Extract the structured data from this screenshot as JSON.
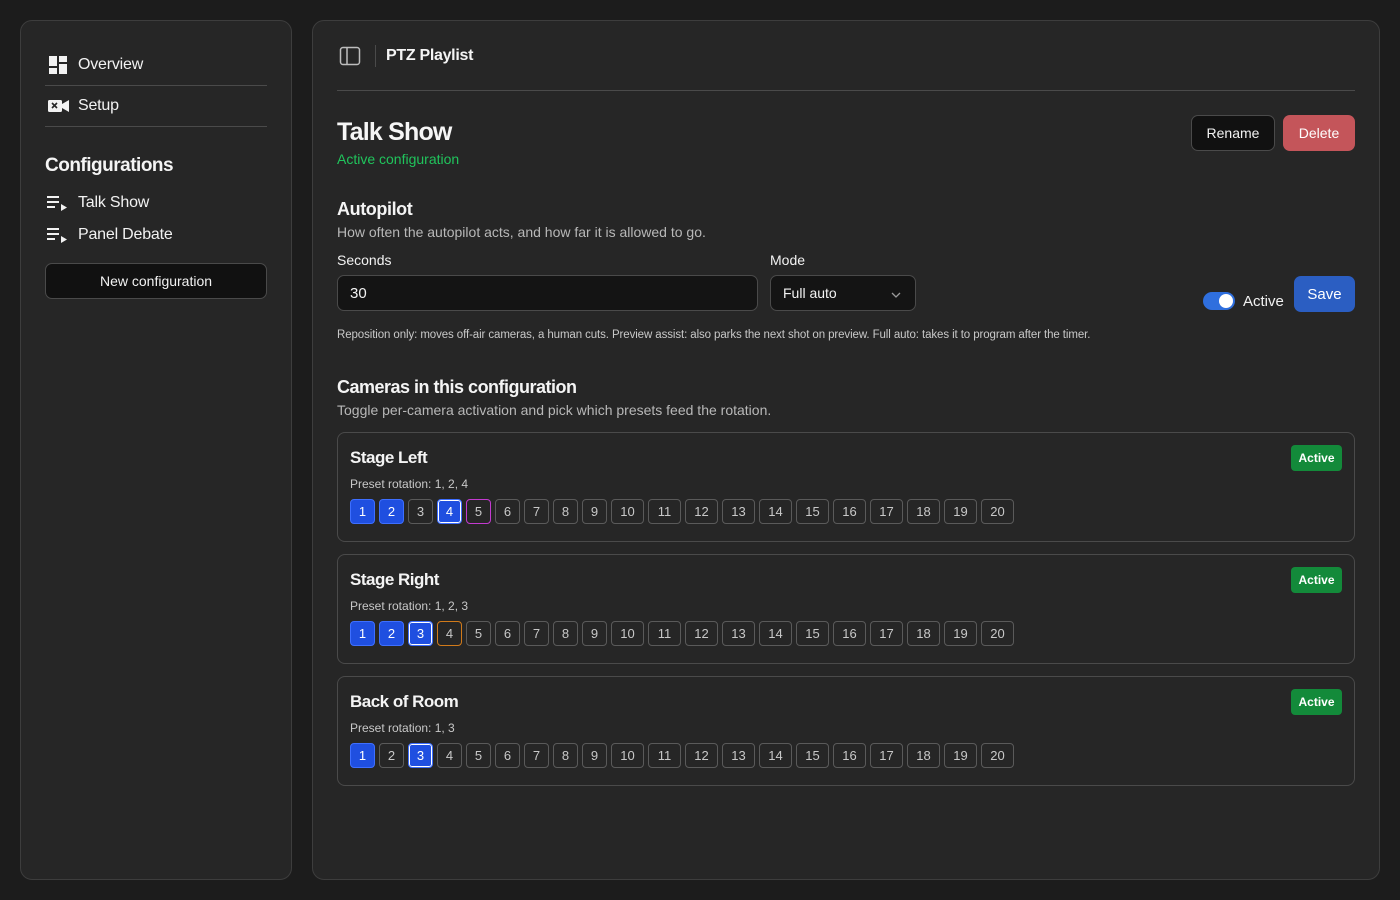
{
  "sidebar": {
    "nav": [
      {
        "label": "Overview",
        "icon": "dashboard-icon"
      },
      {
        "label": "Setup",
        "icon": "camera-icon"
      }
    ],
    "section_title": "Configurations",
    "configs": [
      {
        "label": "Talk Show",
        "icon": "playlist-icon"
      },
      {
        "label": "Panel Debate",
        "icon": "playlist-icon"
      }
    ],
    "new_button": "New configuration"
  },
  "topbar": {
    "title": "PTZ Playlist",
    "toggle_icon": "sidebar-toggle-icon"
  },
  "header": {
    "title": "Talk Show",
    "subtitle": "Active configuration",
    "rename_label": "Rename",
    "delete_label": "Delete"
  },
  "autopilot": {
    "title": "Autopilot",
    "description": "How often the autopilot acts, and how far it is allowed to go.",
    "seconds_label": "Seconds",
    "seconds_value": "30",
    "mode_label": "Mode",
    "mode_value": "Full auto",
    "active_label": "Active",
    "active": true,
    "save_label": "Save",
    "help": "Reposition only: moves off-air cameras, a human cuts. Preview assist: also parks the next shot on preview. Full auto: takes it to program after the timer."
  },
  "cameras": {
    "title": "Cameras in this configuration",
    "description": "Toggle per-camera activation and pick which presets feed the rotation.",
    "items": [
      {
        "name": "Stage Left",
        "rotation": "Preset rotation: 1, 2, 4",
        "badge": "Active",
        "selected": [
          1,
          2,
          4
        ],
        "live": [
          4
        ],
        "program": [
          5
        ],
        "preview": []
      },
      {
        "name": "Stage Right",
        "rotation": "Preset rotation: 1, 2, 3",
        "badge": "Active",
        "selected": [
          1,
          2,
          3
        ],
        "live": [
          3
        ],
        "program": [],
        "preview": [
          4
        ]
      },
      {
        "name": "Back of Room",
        "rotation": "Preset rotation: 1, 3",
        "badge": "Active",
        "selected": [
          1,
          3
        ],
        "live": [
          3
        ],
        "program": [],
        "preview": []
      }
    ],
    "presets": [
      "1",
      "2",
      "3",
      "4",
      "5",
      "6",
      "7",
      "8",
      "9",
      "10",
      "11",
      "12",
      "13",
      "14",
      "15",
      "16",
      "17",
      "18",
      "19",
      "20"
    ]
  },
  "colors": {
    "accent": "#2b5ec2",
    "success": "#20c45c",
    "danger": "#c4555a",
    "preset_selected": "#1f4fe0",
    "program_border": "#c33ad0",
    "preview_border": "#d17a1a"
  }
}
